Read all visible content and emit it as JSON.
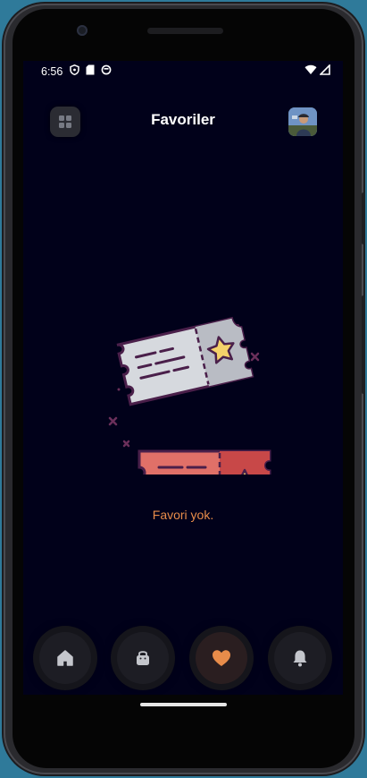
{
  "status_bar": {
    "time": "6:56",
    "left_icons": [
      "shield-icon",
      "sd-card-icon",
      "sync-icon"
    ],
    "right_icons": [
      "wifi-icon",
      "signal-icon"
    ]
  },
  "header": {
    "title": "Favoriler",
    "menu_icon": "grid-icon",
    "avatar": "profile-avatar"
  },
  "empty_state": {
    "illustration": "tickets-illustration",
    "message": "Favori yok."
  },
  "bottom_nav": {
    "items": [
      {
        "icon": "home-icon",
        "active": false
      },
      {
        "icon": "shopping-bag-icon",
        "active": false
      },
      {
        "icon": "heart-icon",
        "active": true
      },
      {
        "icon": "bell-icon",
        "active": false
      }
    ]
  },
  "colors": {
    "background": "#01011a",
    "accent": "#e88c4a",
    "ticket_red": "#c84848",
    "ticket_gray": "#d6d9de",
    "star": "#f5d26a",
    "outline": "#4a1f4a"
  }
}
